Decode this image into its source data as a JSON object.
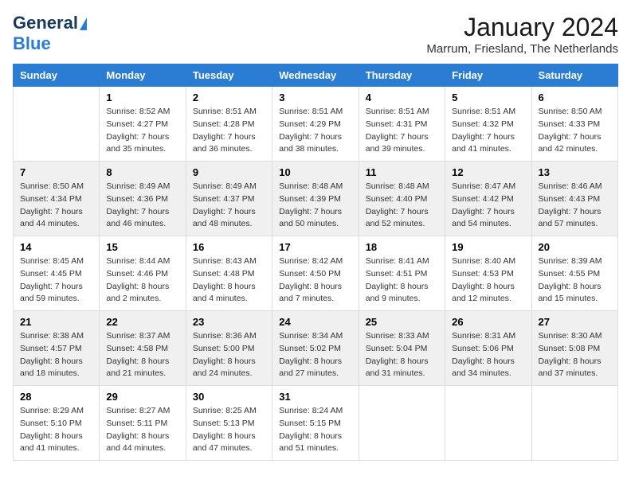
{
  "header": {
    "logo_line1": "General",
    "logo_line2": "Blue",
    "title": "January 2024",
    "subtitle": "Marrum, Friesland, The Netherlands"
  },
  "weekdays": [
    "Sunday",
    "Monday",
    "Tuesday",
    "Wednesday",
    "Thursday",
    "Friday",
    "Saturday"
  ],
  "weeks": [
    [
      {
        "day": "",
        "sunrise": "",
        "sunset": "",
        "daylight": ""
      },
      {
        "day": "1",
        "sunrise": "Sunrise: 8:52 AM",
        "sunset": "Sunset: 4:27 PM",
        "daylight": "Daylight: 7 hours and 35 minutes."
      },
      {
        "day": "2",
        "sunrise": "Sunrise: 8:51 AM",
        "sunset": "Sunset: 4:28 PM",
        "daylight": "Daylight: 7 hours and 36 minutes."
      },
      {
        "day": "3",
        "sunrise": "Sunrise: 8:51 AM",
        "sunset": "Sunset: 4:29 PM",
        "daylight": "Daylight: 7 hours and 38 minutes."
      },
      {
        "day": "4",
        "sunrise": "Sunrise: 8:51 AM",
        "sunset": "Sunset: 4:31 PM",
        "daylight": "Daylight: 7 hours and 39 minutes."
      },
      {
        "day": "5",
        "sunrise": "Sunrise: 8:51 AM",
        "sunset": "Sunset: 4:32 PM",
        "daylight": "Daylight: 7 hours and 41 minutes."
      },
      {
        "day": "6",
        "sunrise": "Sunrise: 8:50 AM",
        "sunset": "Sunset: 4:33 PM",
        "daylight": "Daylight: 7 hours and 42 minutes."
      }
    ],
    [
      {
        "day": "7",
        "sunrise": "Sunrise: 8:50 AM",
        "sunset": "Sunset: 4:34 PM",
        "daylight": "Daylight: 7 hours and 44 minutes."
      },
      {
        "day": "8",
        "sunrise": "Sunrise: 8:49 AM",
        "sunset": "Sunset: 4:36 PM",
        "daylight": "Daylight: 7 hours and 46 minutes."
      },
      {
        "day": "9",
        "sunrise": "Sunrise: 8:49 AM",
        "sunset": "Sunset: 4:37 PM",
        "daylight": "Daylight: 7 hours and 48 minutes."
      },
      {
        "day": "10",
        "sunrise": "Sunrise: 8:48 AM",
        "sunset": "Sunset: 4:39 PM",
        "daylight": "Daylight: 7 hours and 50 minutes."
      },
      {
        "day": "11",
        "sunrise": "Sunrise: 8:48 AM",
        "sunset": "Sunset: 4:40 PM",
        "daylight": "Daylight: 7 hours and 52 minutes."
      },
      {
        "day": "12",
        "sunrise": "Sunrise: 8:47 AM",
        "sunset": "Sunset: 4:42 PM",
        "daylight": "Daylight: 7 hours and 54 minutes."
      },
      {
        "day": "13",
        "sunrise": "Sunrise: 8:46 AM",
        "sunset": "Sunset: 4:43 PM",
        "daylight": "Daylight: 7 hours and 57 minutes."
      }
    ],
    [
      {
        "day": "14",
        "sunrise": "Sunrise: 8:45 AM",
        "sunset": "Sunset: 4:45 PM",
        "daylight": "Daylight: 7 hours and 59 minutes."
      },
      {
        "day": "15",
        "sunrise": "Sunrise: 8:44 AM",
        "sunset": "Sunset: 4:46 PM",
        "daylight": "Daylight: 8 hours and 2 minutes."
      },
      {
        "day": "16",
        "sunrise": "Sunrise: 8:43 AM",
        "sunset": "Sunset: 4:48 PM",
        "daylight": "Daylight: 8 hours and 4 minutes."
      },
      {
        "day": "17",
        "sunrise": "Sunrise: 8:42 AM",
        "sunset": "Sunset: 4:50 PM",
        "daylight": "Daylight: 8 hours and 7 minutes."
      },
      {
        "day": "18",
        "sunrise": "Sunrise: 8:41 AM",
        "sunset": "Sunset: 4:51 PM",
        "daylight": "Daylight: 8 hours and 9 minutes."
      },
      {
        "day": "19",
        "sunrise": "Sunrise: 8:40 AM",
        "sunset": "Sunset: 4:53 PM",
        "daylight": "Daylight: 8 hours and 12 minutes."
      },
      {
        "day": "20",
        "sunrise": "Sunrise: 8:39 AM",
        "sunset": "Sunset: 4:55 PM",
        "daylight": "Daylight: 8 hours and 15 minutes."
      }
    ],
    [
      {
        "day": "21",
        "sunrise": "Sunrise: 8:38 AM",
        "sunset": "Sunset: 4:57 PM",
        "daylight": "Daylight: 8 hours and 18 minutes."
      },
      {
        "day": "22",
        "sunrise": "Sunrise: 8:37 AM",
        "sunset": "Sunset: 4:58 PM",
        "daylight": "Daylight: 8 hours and 21 minutes."
      },
      {
        "day": "23",
        "sunrise": "Sunrise: 8:36 AM",
        "sunset": "Sunset: 5:00 PM",
        "daylight": "Daylight: 8 hours and 24 minutes."
      },
      {
        "day": "24",
        "sunrise": "Sunrise: 8:34 AM",
        "sunset": "Sunset: 5:02 PM",
        "daylight": "Daylight: 8 hours and 27 minutes."
      },
      {
        "day": "25",
        "sunrise": "Sunrise: 8:33 AM",
        "sunset": "Sunset: 5:04 PM",
        "daylight": "Daylight: 8 hours and 31 minutes."
      },
      {
        "day": "26",
        "sunrise": "Sunrise: 8:31 AM",
        "sunset": "Sunset: 5:06 PM",
        "daylight": "Daylight: 8 hours and 34 minutes."
      },
      {
        "day": "27",
        "sunrise": "Sunrise: 8:30 AM",
        "sunset": "Sunset: 5:08 PM",
        "daylight": "Daylight: 8 hours and 37 minutes."
      }
    ],
    [
      {
        "day": "28",
        "sunrise": "Sunrise: 8:29 AM",
        "sunset": "Sunset: 5:10 PM",
        "daylight": "Daylight: 8 hours and 41 minutes."
      },
      {
        "day": "29",
        "sunrise": "Sunrise: 8:27 AM",
        "sunset": "Sunset: 5:11 PM",
        "daylight": "Daylight: 8 hours and 44 minutes."
      },
      {
        "day": "30",
        "sunrise": "Sunrise: 8:25 AM",
        "sunset": "Sunset: 5:13 PM",
        "daylight": "Daylight: 8 hours and 47 minutes."
      },
      {
        "day": "31",
        "sunrise": "Sunrise: 8:24 AM",
        "sunset": "Sunset: 5:15 PM",
        "daylight": "Daylight: 8 hours and 51 minutes."
      },
      {
        "day": "",
        "sunrise": "",
        "sunset": "",
        "daylight": ""
      },
      {
        "day": "",
        "sunrise": "",
        "sunset": "",
        "daylight": ""
      },
      {
        "day": "",
        "sunrise": "",
        "sunset": "",
        "daylight": ""
      }
    ]
  ]
}
